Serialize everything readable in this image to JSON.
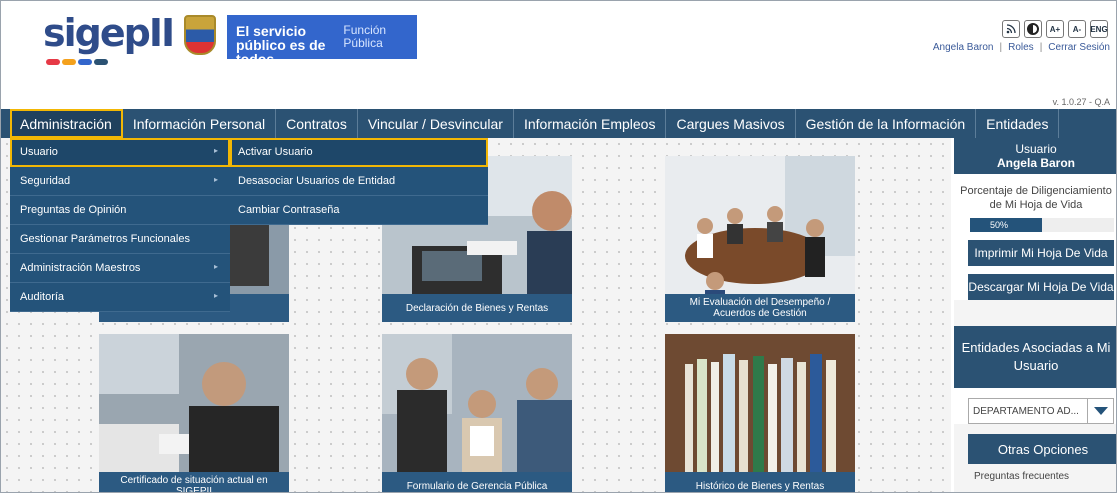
{
  "header": {
    "logo_text": "sigepII",
    "gov_banner_line1": "El servicio público es de todos",
    "gov_banner_line2": "Función Pública",
    "tools": [
      "rss-icon",
      "contrast-icon",
      "A+",
      "A-",
      "ENG"
    ],
    "user_name": "Angela Baron",
    "roles_link": "Roles",
    "logout_link": "Cerrar Sesión",
    "version": "v. 1.0.27 - Q.A"
  },
  "nav": {
    "items": [
      "Administración",
      "Información Personal",
      "Contratos",
      "Vincular / Desvincular",
      "Información Empleos",
      "Cargues Masivos",
      "Gestión de la Información",
      "Entidades"
    ],
    "active_index": 0
  },
  "dropdown": {
    "items": [
      "Usuario",
      "Seguridad",
      "Preguntas de Opinión",
      "Gestionar Parámetros Funcionales",
      "Administración Maestros",
      "Auditoría"
    ],
    "submenu": [
      "Activar Usuario",
      "Desasociar Usuarios de Entidad",
      "Cambiar Contraseña"
    ]
  },
  "tiles": [
    "",
    "Declaración de Bienes y Rentas",
    "Mi Evaluación del Desempeño / Acuerdos de Gestión",
    "Certificado de situación actual en SIGEPII",
    "Formulario de Gerencia Pública",
    "Histórico de Bienes y Rentas"
  ],
  "sidebar": {
    "user_title": "Usuario",
    "user_name": "Angela Baron",
    "progress_label": "Porcentaje de Diligenciamiento de Mi Hoja de Vida",
    "progress_value": 0.5,
    "progress_text": "50%",
    "print_button": "Imprimir Mi Hoja De Vida",
    "download_button": "Descargar Mi Hoja De Vida",
    "entities_title": "Entidades Asociadas a Mi Usuario",
    "entity_select": "DEPARTAMENTO AD...",
    "other_title": "Otras Opciones",
    "faq_link": "Preguntas frecuentes"
  },
  "colors": {
    "nav": "#2b5273",
    "highlight": "#f2b705",
    "gov_blue": "#3366cc"
  }
}
